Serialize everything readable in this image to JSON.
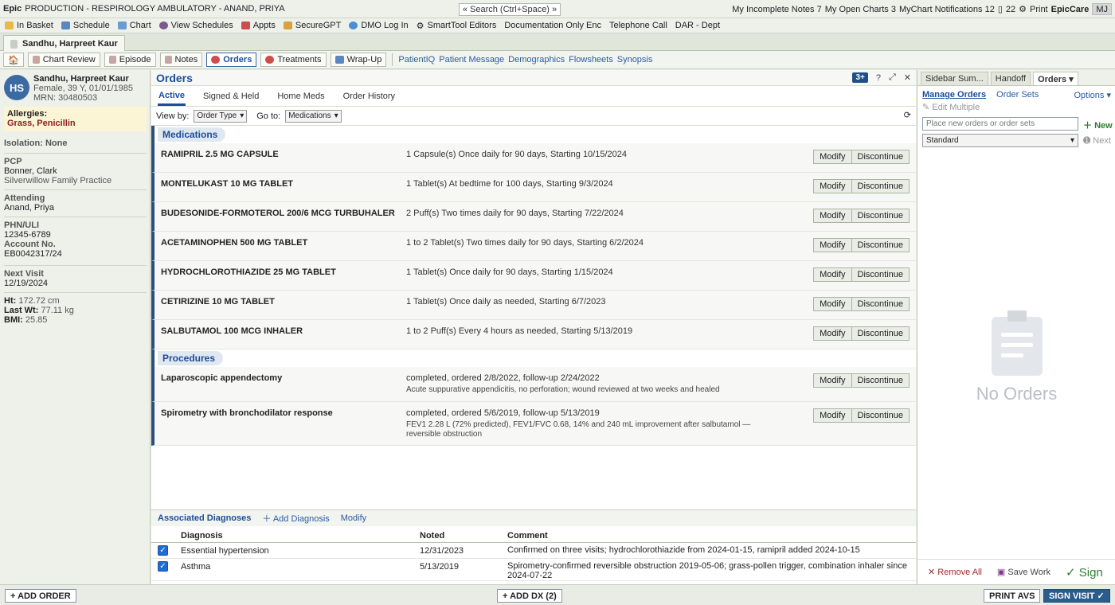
{
  "titlebar": {
    "app": "Epic",
    "context": "PRODUCTION - RESPIROLOGY AMBULATORY - ANAND, PRIYA",
    "search": "« Search (Ctrl+Space) »",
    "incomplete_notes": "My Incomplete Notes 7",
    "open_charts": "My Open Charts 3",
    "mychart": "MyChart Notifications 12",
    "msg_count": "22",
    "print": "Print",
    "brand": "EpicCare",
    "user": "MJ"
  },
  "toolbar": {
    "items": [
      "In Basket",
      "Schedule",
      "Chart",
      "View Schedules",
      "Appts",
      "SecureGPT",
      "DMO Log In",
      "SmartTool Editors",
      "Documentation Only Enc",
      "Telephone Call",
      "DAR - Dept"
    ]
  },
  "patient_tab": {
    "label": "Sandhu, Harpreet Kaur"
  },
  "activities": {
    "buttons": [
      "Chart Review",
      "Episode",
      "Notes",
      "Orders",
      "Treatments",
      "Wrap-Up"
    ],
    "links": [
      "PatientIQ",
      "Patient Message",
      "Demographics",
      "Flowsheets",
      "Synopsis"
    ]
  },
  "patient": {
    "initials": "HS",
    "name": "Sandhu, Harpreet Kaur",
    "demo": "Female, 39 Y, 01/01/1985",
    "mrn": "MRN: 30480503",
    "allergies_label": "Allergies:",
    "allergies": "Grass, Penicillin",
    "isolation": "Isolation: None",
    "pcp_label": "PCP",
    "pcp": "Bonner, Clark",
    "pcp_practice": "Silverwillow Family Practice",
    "attending_label": "Attending",
    "attending": "Anand, Priya",
    "phn_label": "PHN/ULI",
    "phn": "12345-6789",
    "account_label": "Account No.",
    "account": "EB0042317/24",
    "next_visit_label": "Next Visit",
    "next_visit": "12/19/2024",
    "ht_label": "Ht:",
    "ht": "172.72 cm",
    "wt_label": "Last Wt:",
    "wt": "77.11 kg",
    "bmi_label": "BMI:",
    "bmi": "25.85"
  },
  "orders": {
    "title": "Orders",
    "badge": "3+",
    "tabs": [
      "Active",
      "Signed & Held",
      "Home Meds",
      "Order History"
    ],
    "view_by_label": "View by:",
    "view_by": "Order Type",
    "goto_label": "Go to:",
    "goto": "Medications",
    "modify": "Modify",
    "discontinue": "Discontinue",
    "medications_label": "Medications",
    "procedures_label": "Procedures",
    "medications": [
      {
        "name": "RAMIPRIL 2.5 MG CAPSULE",
        "sig": "1 Capsule(s) Once daily for 90 days, Starting 10/15/2024"
      },
      {
        "name": "MONTELUKAST 10 MG TABLET",
        "sig": "1 Tablet(s) At bedtime for 100 days, Starting 9/3/2024"
      },
      {
        "name": "BUDESONIDE-FORMOTEROL 200/6 MCG TURBUHALER",
        "sig": "2 Puff(s) Two times daily for 90 days, Starting 7/22/2024"
      },
      {
        "name": "ACETAMINOPHEN 500 MG TABLET",
        "sig": "1 to 2 Tablet(s) Two times daily for 90 days, Starting 6/2/2024"
      },
      {
        "name": "HYDROCHLOROTHIAZIDE 25 MG TABLET",
        "sig": "1 Tablet(s) Once daily for 90 days, Starting 1/15/2024"
      },
      {
        "name": "CETIRIZINE 10 MG TABLET",
        "sig": "1 Tablet(s) Once daily as needed, Starting 6/7/2023"
      },
      {
        "name": "SALBUTAMOL 100 MCG INHALER",
        "sig": "1 to 2 Puff(s) Every 4 hours as needed, Starting 5/13/2019"
      }
    ],
    "procedures": [
      {
        "name": "Laparoscopic appendectomy",
        "sig": "completed, ordered 2/8/2022, follow-up 2/24/2022",
        "note": "Acute suppurative appendicitis, no perforation; wound reviewed at two weeks and healed"
      },
      {
        "name": "Spirometry with bronchodilator response",
        "sig": "completed, ordered 5/6/2019, follow-up 5/13/2019",
        "note": "FEV1 2.28 L (72% predicted), FEV1/FVC 0.68, 14% and 240 mL improvement after salbutamol — reversible obstruction"
      }
    ]
  },
  "diagnoses": {
    "title": "Associated Diagnoses",
    "add": "Add Diagnosis",
    "modify": "Modify",
    "columns": [
      "Diagnosis",
      "Noted",
      "Comment"
    ],
    "rows": [
      {
        "diagnosis": "Essential hypertension",
        "noted": "12/31/2023",
        "comment": "Confirmed on three visits; hydrochlorothiazide from 2024-01-15, ramipril added 2024-10-15"
      },
      {
        "diagnosis": "Asthma",
        "noted": "5/13/2019",
        "comment": "Spirometry-confirmed reversible obstruction 2019-05-06; grass-pollen trigger, combination inhaler since 2024-07-22"
      }
    ]
  },
  "sidebar": {
    "tabs": [
      "Sidebar Sum...",
      "Handoff",
      "Orders ▾"
    ],
    "manage_orders": "Manage Orders",
    "order_sets": "Order Sets",
    "options": "Options ▾",
    "edit_multiple": "Edit Multiple",
    "input_placeholder": "Place new orders or order sets",
    "new": "New",
    "standard": "Standard",
    "next": "Next",
    "empty": "No Orders",
    "remove_all": "Remove All",
    "save_work": "Save Work",
    "sign": "Sign"
  },
  "bottom": {
    "add_order": "+ ADD ORDER",
    "add_dx": "+ ADD DX (2)",
    "print_avs": "PRINT AVS",
    "sign_visit": "SIGN VISIT ✓"
  }
}
